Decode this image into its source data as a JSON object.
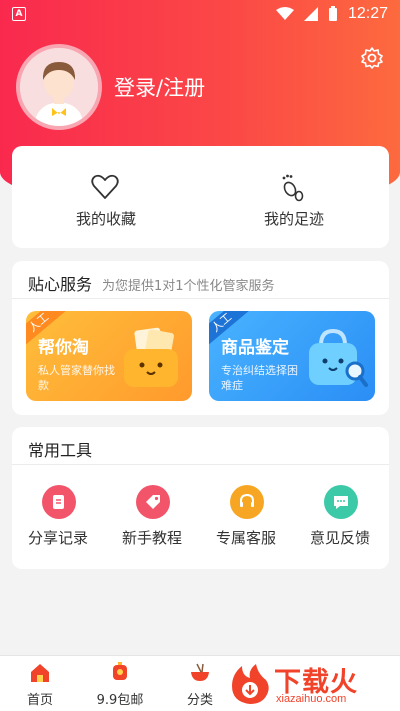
{
  "status_bar": {
    "time": "12:27",
    "notification": "A"
  },
  "header": {
    "login_label": "登录/注册"
  },
  "shortcuts": [
    {
      "label": "我的收藏",
      "icon": "heart-icon"
    },
    {
      "label": "我的足迹",
      "icon": "footprint-icon"
    }
  ],
  "service": {
    "title": "贴心服务",
    "subtitle": "为您提供1对1个性化管家服务",
    "promos": [
      {
        "tag": "人工",
        "title": "帮你淘",
        "desc": "私人管家替你找款"
      },
      {
        "tag": "人工",
        "title": "商品鉴定",
        "desc": "专治纠结选择困难症"
      }
    ]
  },
  "tools": {
    "title": "常用工具",
    "items": [
      {
        "label": "分享记录",
        "icon": "share-record-icon",
        "color": "#f2546a"
      },
      {
        "label": "新手教程",
        "icon": "tag-icon",
        "color": "#f2546a"
      },
      {
        "label": "专属客服",
        "icon": "headset-icon",
        "color": "#f7a623"
      },
      {
        "label": "意见反馈",
        "icon": "chat-icon",
        "color": "#3cc9a8"
      }
    ]
  },
  "bottom_nav": [
    {
      "label": "首页",
      "icon": "home-icon"
    },
    {
      "label": "9.9包邮",
      "icon": "lantern-icon"
    },
    {
      "label": "分类",
      "icon": "bowl-icon"
    }
  ],
  "watermark": {
    "text": "下载火",
    "url": "xiazaihuo.com"
  },
  "colors": {
    "brand": "#f9294e",
    "accent_orange": "#ff9a2c",
    "accent_blue": "#2a8ef5"
  }
}
